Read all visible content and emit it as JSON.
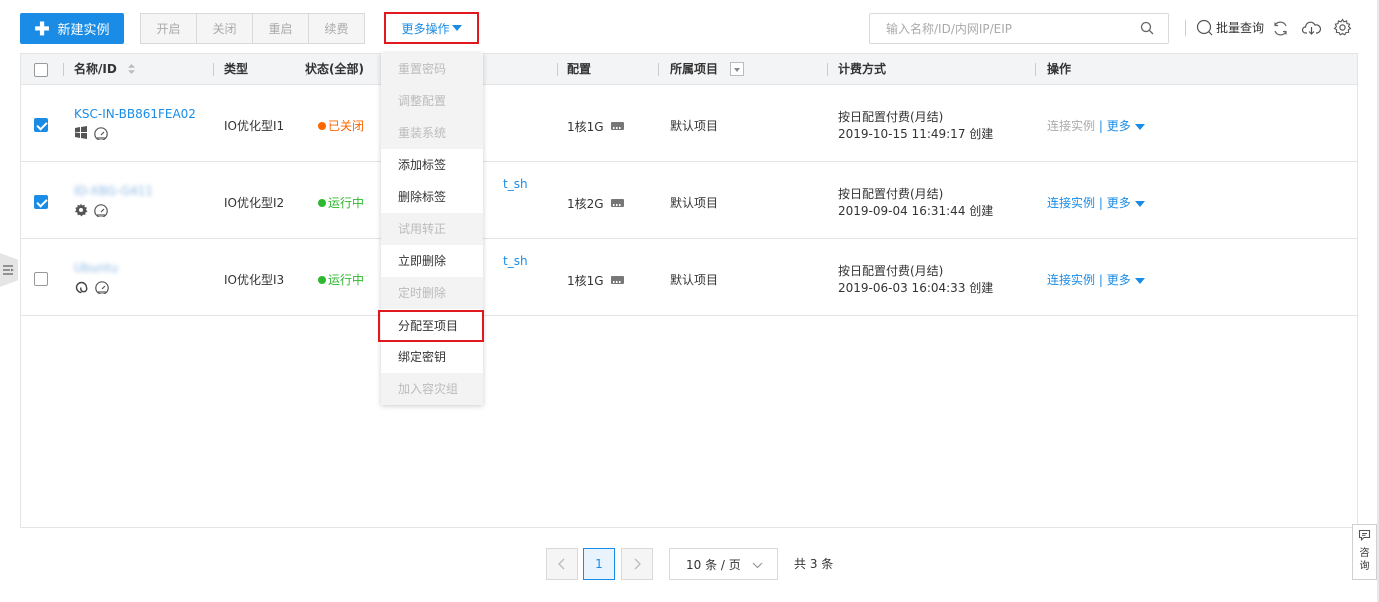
{
  "toolbar": {
    "new_instance": "新建实例",
    "group_buttons": [
      "开启",
      "关闭",
      "重启",
      "续费"
    ],
    "more_actions": "更多操作",
    "search_placeholder": "输入名称/ID/内网IP/EIP",
    "batch_query": "批量查询"
  },
  "table": {
    "headers": {
      "name": "名称/ID",
      "type": "类型",
      "status": "状态(全部)",
      "config": "配置",
      "project": "所属项目",
      "billing": "计费方式",
      "ops": "操作"
    },
    "rows": [
      {
        "checked": true,
        "name": "KSC-IN-BB861FEA02",
        "name_blurred": false,
        "type": "IO优化型I1",
        "status": "已关闭",
        "status_color": "#ff6600",
        "ip_partial": "",
        "config": "1核1G",
        "project": "默认项目",
        "billing": "按日配置付费(月结)",
        "created": "2019-10-15 11:49:17 创建",
        "connect": "连接实例",
        "connect_enabled": false,
        "more": "更多",
        "os_icon": "windows-icon"
      },
      {
        "checked": true,
        "name": "ID-XBG-G411",
        "name_blurred": true,
        "type": "IO优化型I2",
        "status": "运行中",
        "status_color": "#2eb82e",
        "ip_partial": "t_sh",
        "config": "1核2G",
        "project": "默认项目",
        "billing": "按日配置付费(月结)",
        "created": "2019-09-04 16:31:44 创建",
        "connect": "连接实例",
        "connect_enabled": true,
        "more": "更多",
        "os_icon": "gear-os-icon"
      },
      {
        "checked": false,
        "name": "Ubuntu",
        "name_blurred": true,
        "type": "IO优化型I3",
        "status": "运行中",
        "status_color": "#2eb82e",
        "ip_partial": "t_sh",
        "config": "1核1G",
        "project": "默认项目",
        "billing": "按日配置付费(月结)",
        "created": "2019-06-03 16:04:33 创建",
        "connect": "连接实例",
        "connect_enabled": true,
        "more": "更多",
        "os_icon": "debian-icon"
      }
    ]
  },
  "menu": {
    "items": [
      {
        "label": "重置密码",
        "disabled": true
      },
      {
        "label": "调整配置",
        "disabled": true
      },
      {
        "label": "重装系统",
        "disabled": true
      },
      {
        "label": "添加标签",
        "disabled": false
      },
      {
        "label": "删除标签",
        "disabled": false
      },
      {
        "label": "试用转正",
        "disabled": true
      },
      {
        "label": "立即删除",
        "disabled": false
      },
      {
        "label": "定时删除",
        "disabled": true
      },
      {
        "label": "分配至项目",
        "disabled": false,
        "highlighted": true
      },
      {
        "label": "绑定密钥",
        "disabled": false
      },
      {
        "label": "加入容灾组",
        "disabled": true
      }
    ]
  },
  "pagination": {
    "current_page": "1",
    "page_size": "10 条 / 页",
    "total": "共 3 条"
  },
  "consult": {
    "label_line1": "咨",
    "label_line2": "询"
  },
  "colors": {
    "accent": "#1a8ce6",
    "highlight_border": "#e0191f"
  }
}
